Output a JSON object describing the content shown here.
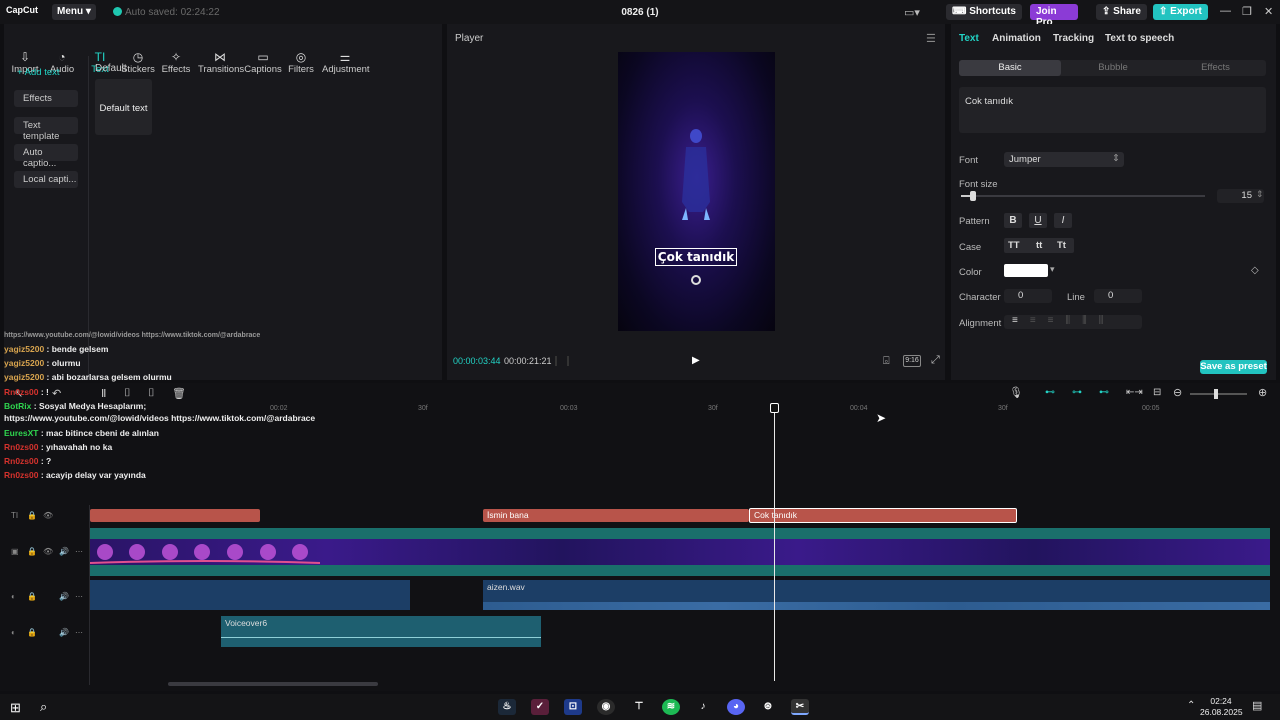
{
  "app": {
    "logo": "CapCut",
    "menu_label": "Menu",
    "autosave": "Auto saved: 02:24:22",
    "project_title": "0826 (1)"
  },
  "titlebar": {
    "shortcuts": "Shortcuts",
    "join_pro": "Join Pro",
    "share": "Share",
    "export": "Export"
  },
  "toolbar": {
    "items": [
      {
        "label": "Import",
        "icon": "import-icon"
      },
      {
        "label": "Audio",
        "icon": "audio-icon"
      },
      {
        "label": "Text",
        "icon": "text-icon"
      },
      {
        "label": "Stickers",
        "icon": "stickers-icon"
      },
      {
        "label": "Effects",
        "icon": "effects-icon"
      },
      {
        "label": "Transitions",
        "icon": "transitions-icon"
      },
      {
        "label": "Captions",
        "icon": "captions-icon"
      },
      {
        "label": "Filters",
        "icon": "filters-icon"
      },
      {
        "label": "Adjustment",
        "icon": "adjustment-icon"
      }
    ]
  },
  "sidebar": {
    "items": [
      "+ Add text",
      "Effects",
      "Text template",
      "Auto captio...",
      "Local capti..."
    ]
  },
  "library": {
    "section": "Default",
    "card_label": "Default text"
  },
  "chat": [
    {
      "user": "yagiz5200",
      "msg": " : bende gelsem"
    },
    {
      "user": "yagiz5200",
      "msg": " : olurmu"
    },
    {
      "user": "yagiz5200",
      "msg": " : abi bozarlarsa gelsem olurmu"
    },
    {
      "user": "Rn0zs00",
      "msg": " : !"
    },
    {
      "user": "BotRix",
      "msg": " : Sosyal Medya Hesaplarım;"
    },
    {
      "user": "",
      "msg": "https://www.youtube.com/@lowid/videos https://www.tiktok.com/@ardabrace"
    },
    {
      "user": "EuresXT",
      "msg": " : mac bitince cbeni de alınlan"
    },
    {
      "user": "Rn0zs00",
      "msg": " : yıhavahah no ka"
    },
    {
      "user": "Rn0zs00",
      "msg": " : ?"
    },
    {
      "user": "Rn0zs00",
      "msg": " : acayip delay var yayında"
    }
  ],
  "player": {
    "title": "Player",
    "overlay_text": "Çok tanıdık",
    "current_time": "00:00:03:44",
    "total_time": "00:00:21:21",
    "ratio": "9:16"
  },
  "props": {
    "tabs": [
      "Text",
      "Animation",
      "Tracking",
      "Text to speech"
    ],
    "subtabs": [
      "Basic",
      "Bubble",
      "Effects"
    ],
    "text_value": "Cok tanıdık",
    "font_label": "Font",
    "font_value": "Jumper",
    "font_size_label": "Font size",
    "font_size_value": "15",
    "font_size_fraction": 0.05,
    "pattern_label": "Pattern",
    "pattern": [
      "B",
      "U",
      "I"
    ],
    "case_label": "Case",
    "case": [
      "TT",
      "tt",
      "Tt"
    ],
    "color_label": "Color",
    "color_value": "#ffffff",
    "character_label": "Character",
    "character_value": "0",
    "line_label": "Line",
    "line_value": "0",
    "alignment_label": "Alignment",
    "save_preset": "Save as preset"
  },
  "timeline": {
    "ruler": [
      "00:02",
      "30f",
      "00:03",
      "30f",
      "00:04",
      "30f",
      "00:05"
    ],
    "clips": {
      "text1": "İsmin bana",
      "text2": "Cok tanıdık",
      "audio1": "aizen.wav",
      "voice": "Voiceover6"
    }
  },
  "taskbar": {
    "time": "02:24",
    "date": "26.08.2025"
  },
  "colors": {
    "accent": "#22d3c5",
    "join_pro": "#8b3bd6",
    "text_clip": "#b8544a",
    "video_track": "#1a6f6b",
    "audio_track": "#1c3e66"
  }
}
